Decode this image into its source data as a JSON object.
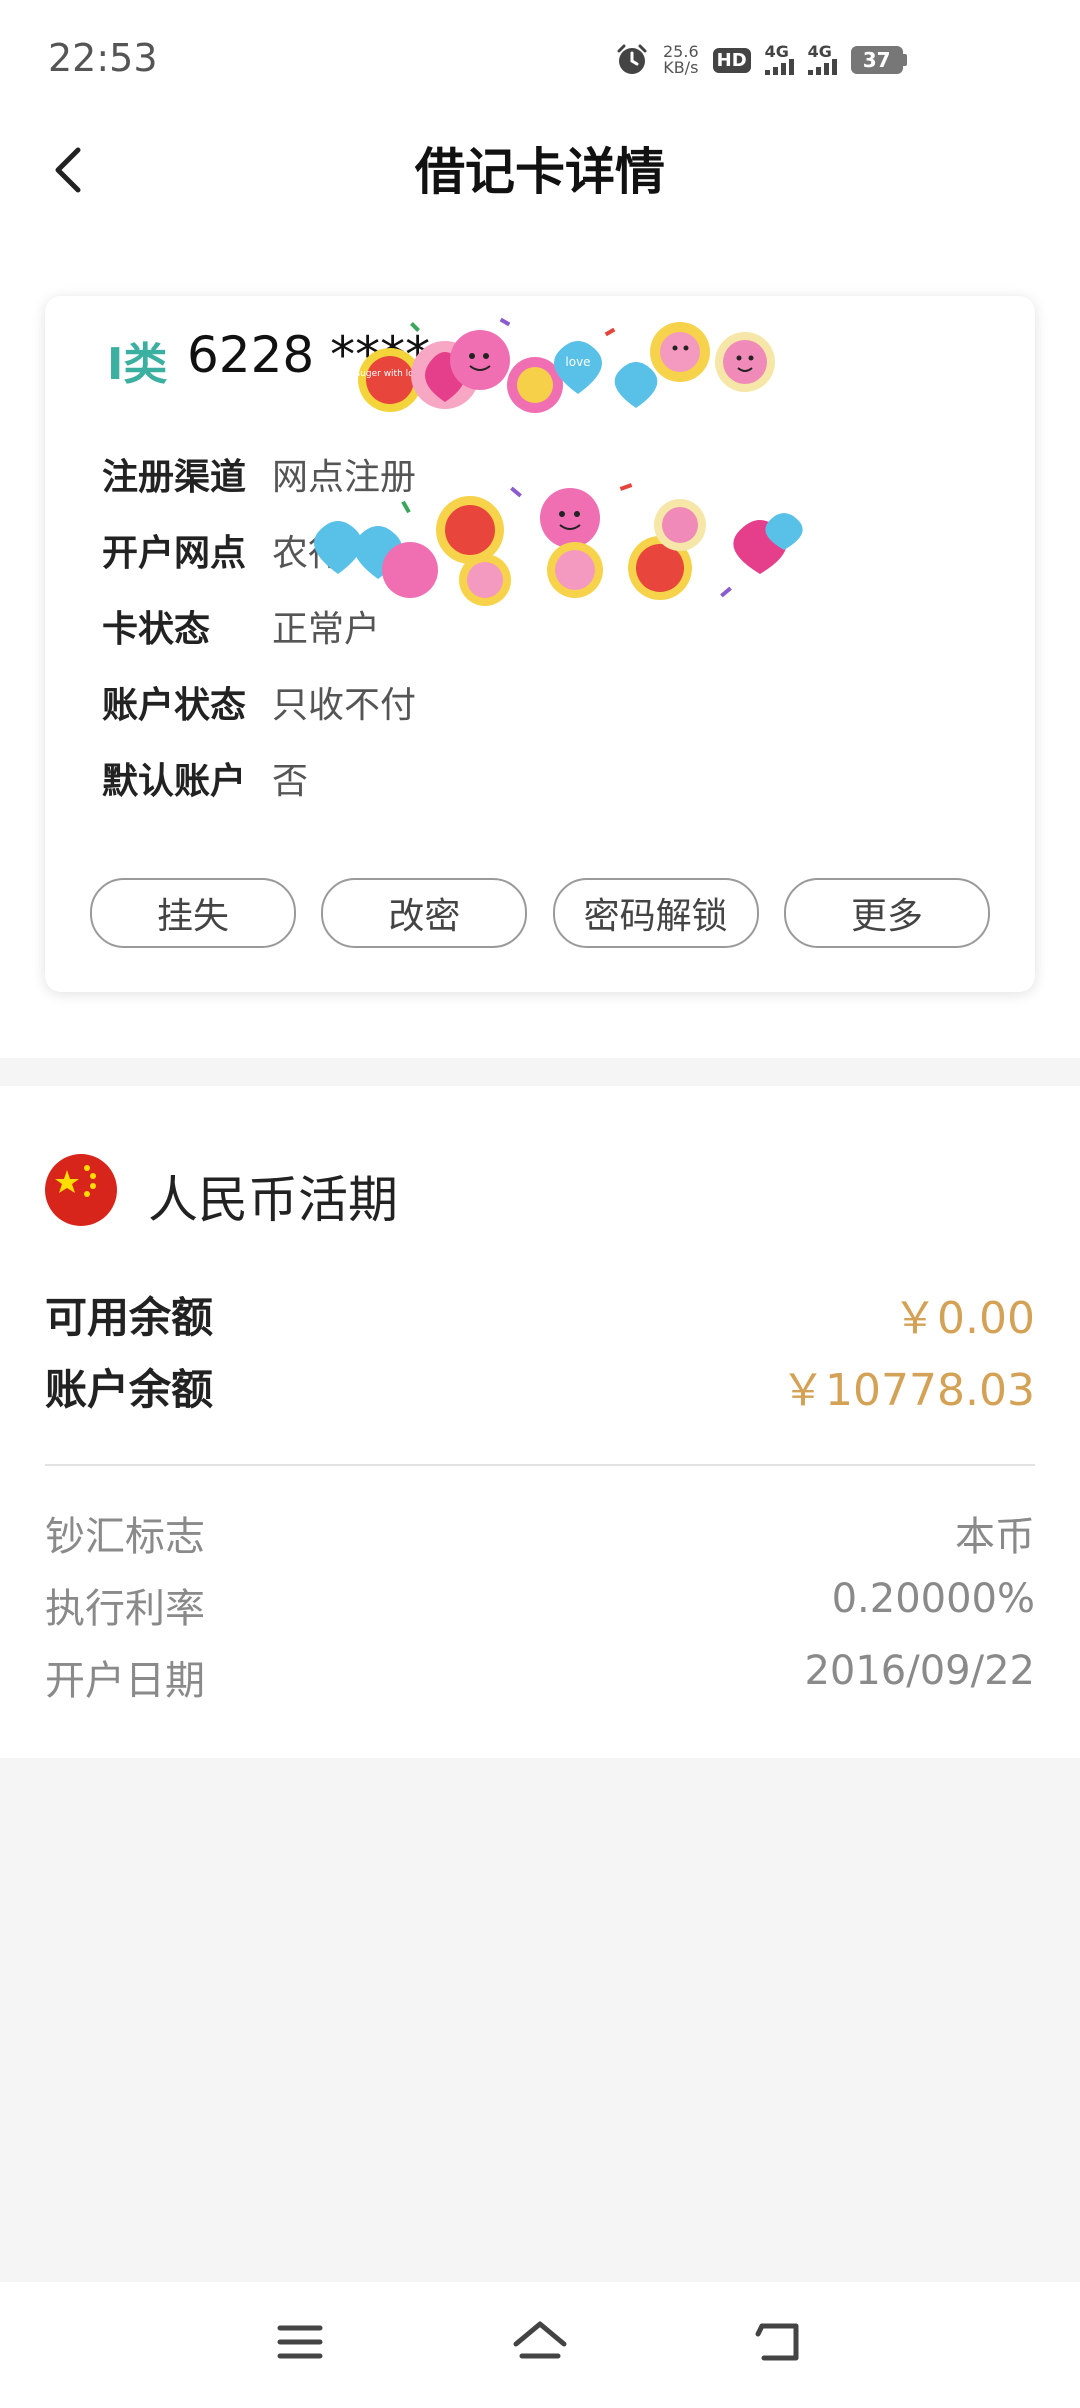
{
  "status_bar": {
    "time": "22:53",
    "speed_value": "25.6",
    "speed_unit": "KB/s",
    "hd_label": "HD",
    "net1": "4G",
    "net2": "4G",
    "battery": "37"
  },
  "header": {
    "title": "借记卡详情"
  },
  "card": {
    "class_label": "I类",
    "card_number": "6228 ****",
    "rows": [
      {
        "key": "注册渠道",
        "value": "网点注册"
      },
      {
        "key": "开户网点",
        "value": "农行"
      },
      {
        "key": "卡状态",
        "value": "正常户"
      },
      {
        "key": "账户状态",
        "value": "只收不付"
      },
      {
        "key": "默认账户",
        "value": "否"
      }
    ],
    "buttons": [
      "挂失",
      "改密",
      "密码解锁",
      "更多"
    ]
  },
  "account": {
    "title": "人民币活期",
    "available_label": "可用余额",
    "available_value": "￥0.00",
    "balance_label": "账户余额",
    "balance_value": "￥10778.03",
    "info": [
      {
        "key": "钞汇标志",
        "value": "本币"
      },
      {
        "key": "执行利率",
        "value": "0.20000%"
      },
      {
        "key": "开户日期",
        "value": "2016/09/22"
      }
    ]
  },
  "stickers": [
    "suger with love",
    "love"
  ],
  "icons": [
    "alarm-icon",
    "back-arrow-icon",
    "china-flag-icon",
    "menu-icon",
    "home-icon",
    "return-icon"
  ]
}
